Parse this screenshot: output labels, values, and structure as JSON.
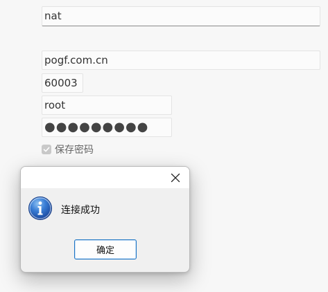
{
  "form": {
    "name_value": "nat",
    "host_value": "pogf.com.cn",
    "port_value": "60003",
    "user_value": "root",
    "password_mask": "●●●●●●●●●",
    "save_password_label": "保存密码",
    "save_password_checked": true
  },
  "dialog": {
    "message": "连接成功",
    "ok_label": "确定",
    "icon": "info-icon",
    "close_icon": "close-icon"
  }
}
